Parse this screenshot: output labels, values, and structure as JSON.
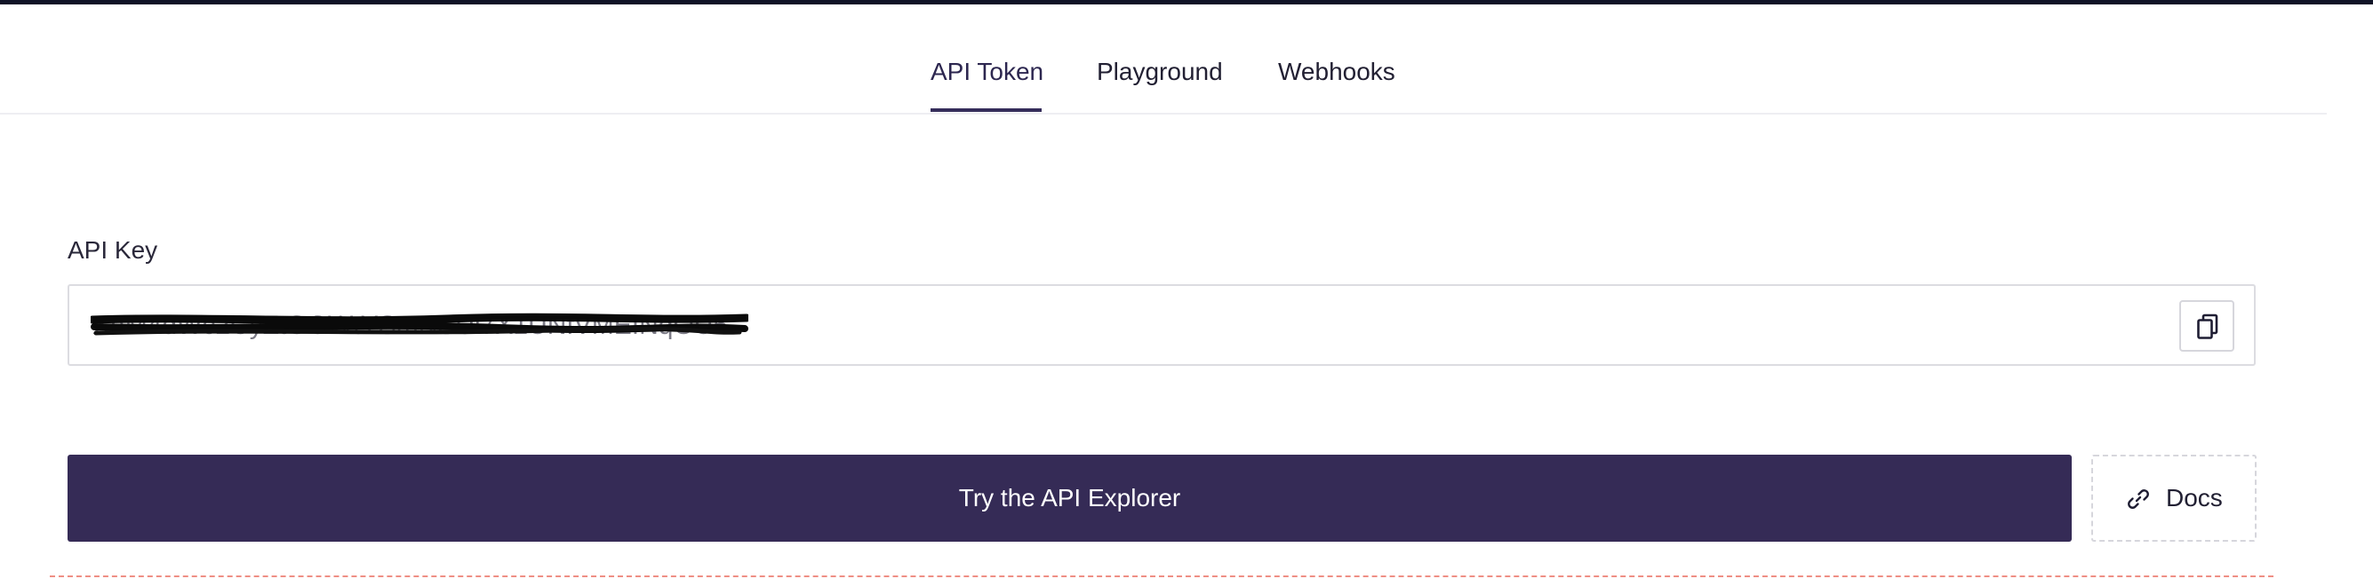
{
  "tabs": [
    {
      "label": "API Token",
      "active": true
    },
    {
      "label": "Playground",
      "active": false
    },
    {
      "label": "Webhooks",
      "active": false
    }
  ],
  "api_key": {
    "label": "API Key",
    "value": "XaM4dWc2CyZtOOWtYSmNSUi7X1UNfVMEINqOU5",
    "redacted": true,
    "copy_icon": "copy-icon"
  },
  "actions": {
    "explorer_label": "Try the API Explorer",
    "docs_label": "Docs",
    "docs_icon": "link-icon"
  },
  "colors": {
    "primary": "#352b56",
    "active_tab": "#2d2750",
    "divider_accent": "#ef8f85",
    "top_bar": "#0f1326"
  }
}
